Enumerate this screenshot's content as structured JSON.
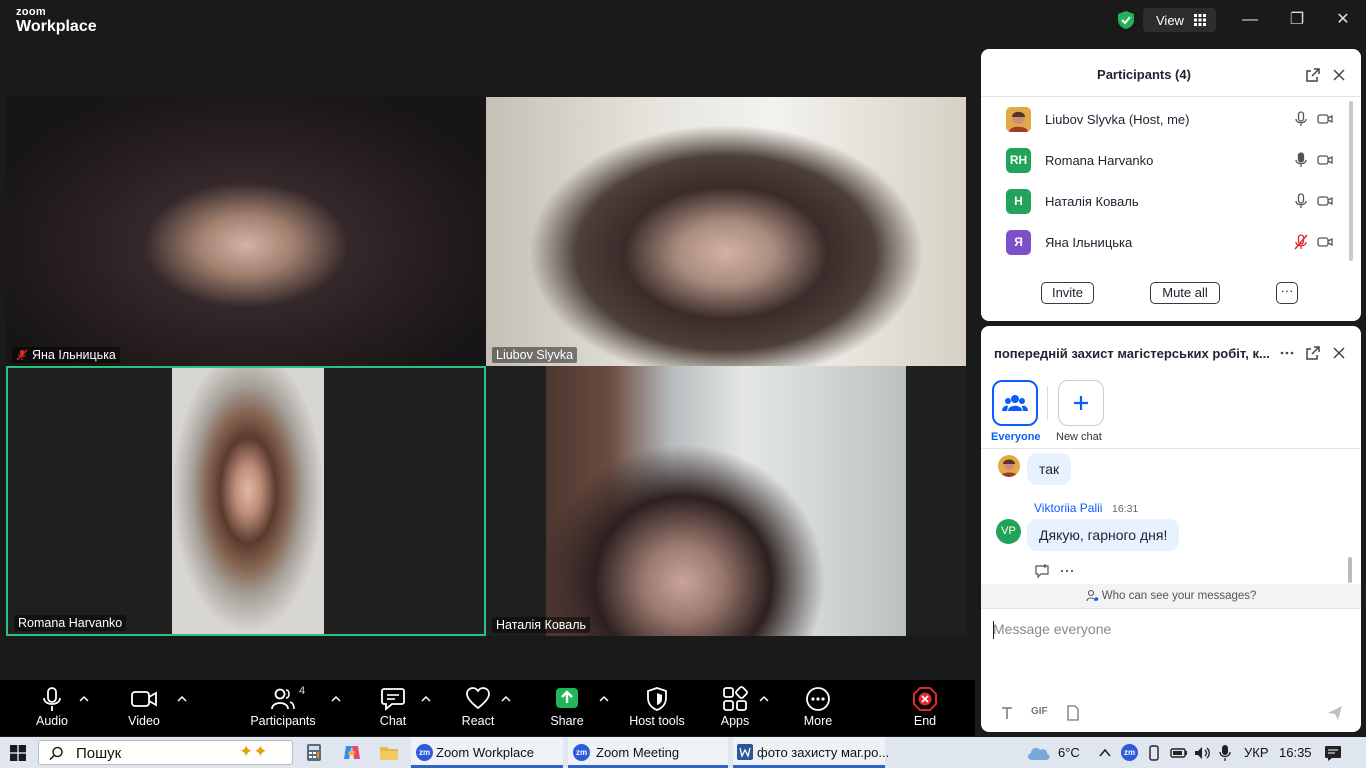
{
  "app": {
    "logo_top": "zoom",
    "logo_bottom": "Workplace",
    "view_label": "View"
  },
  "window": {
    "minimize": "—",
    "restore": "❐",
    "close": "✕"
  },
  "tiles": [
    {
      "name": "Яна Ільницька",
      "muted": true
    },
    {
      "name": "Liubov Slyvka",
      "muted": false
    },
    {
      "name": "Romana Harvanko",
      "muted": false,
      "active_speaker": true
    },
    {
      "name": "Наталія Коваль",
      "muted": false
    }
  ],
  "toolbar": {
    "audio": "Audio",
    "video": "Video",
    "participants": "Participants",
    "participants_count": "4",
    "chat": "Chat",
    "react": "React",
    "share": "Share",
    "host_tools": "Host tools",
    "apps": "Apps",
    "more": "More",
    "end": "End"
  },
  "participants_panel": {
    "title": "Participants (4)",
    "participants": [
      {
        "name": "Liubov Slyvka (Host, me)",
        "initials": "",
        "color": "#e6a23c",
        "mic_muted": false
      },
      {
        "name": "Romana Harvanko",
        "initials": "RH",
        "color": "#22a35a",
        "mic_muted": false
      },
      {
        "name": "Наталія Коваль",
        "initials": "Н",
        "color": "#22a35a",
        "mic_muted": false
      },
      {
        "name": "Яна Ільницька",
        "initials": "Я",
        "color": "#7d4fc9",
        "mic_muted": true
      }
    ],
    "invite": "Invite",
    "mute_all": "Mute all",
    "more": "···"
  },
  "chat_panel": {
    "title": "попередній захист магістерських робіт, к...",
    "everyone": "Everyone",
    "new_chat": "New chat",
    "messages": [
      {
        "sender": "",
        "time": "",
        "text": "так"
      },
      {
        "sender": "Viktoriia Palii",
        "initials": "VP",
        "time": "16:31",
        "text": "Дякую, гарного дня!"
      }
    ],
    "who_can_see": "Who can see your messages?",
    "placeholder": "Message everyone",
    "gif": "GIF"
  },
  "taskbar": {
    "search": "Пошук",
    "apps": [
      "Zoom Workplace",
      "Zoom Meeting",
      "фото захисту маг.ро..."
    ],
    "weather": "6°C",
    "lang": "УКР",
    "time": "16:35"
  },
  "colors": {
    "accent": "#0b5cff",
    "active_speaker": "#29c27f",
    "share": "#1fb75a",
    "end": "#e02828"
  }
}
